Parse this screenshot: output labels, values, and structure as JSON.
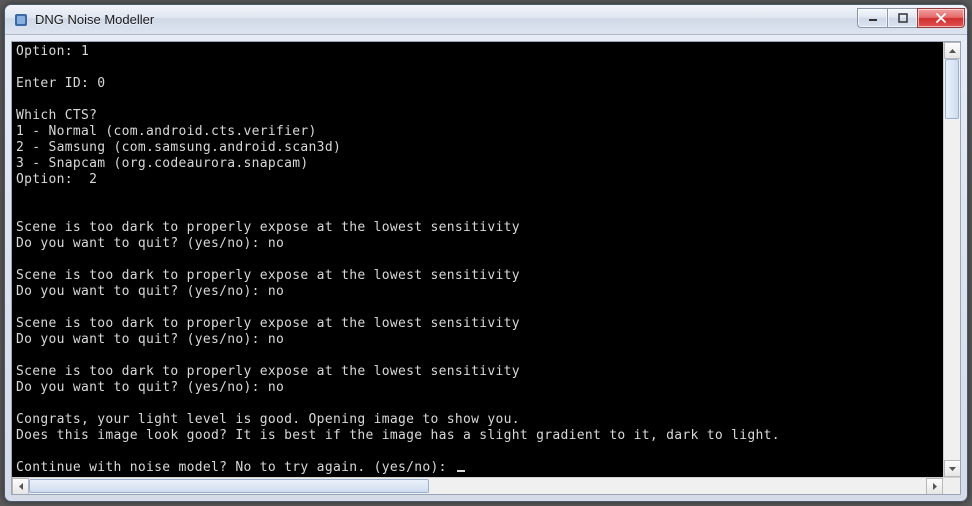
{
  "window": {
    "title": "DNG Noise Modeller"
  },
  "console": {
    "lines": [
      "Option: 1",
      "",
      "Enter ID: 0",
      "",
      "Which CTS?",
      "1 - Normal (com.android.cts.verifier)",
      "2 - Samsung (com.samsung.android.scan3d)",
      "3 - Snapcam (org.codeaurora.snapcam)",
      "Option:  2",
      "",
      "",
      "Scene is too dark to properly expose at the lowest sensitivity",
      "Do you want to quit? (yes/no): no",
      "",
      "Scene is too dark to properly expose at the lowest sensitivity",
      "Do you want to quit? (yes/no): no",
      "",
      "Scene is too dark to properly expose at the lowest sensitivity",
      "Do you want to quit? (yes/no): no",
      "",
      "Scene is too dark to properly expose at the lowest sensitivity",
      "Do you want to quit? (yes/no): no",
      "",
      "Congrats, your light level is good. Opening image to show you.",
      "Does this image look good? It is best if the image has a slight gradient to it, dark to light.",
      "",
      "Continue with noise model? No to try again. (yes/no): "
    ]
  }
}
